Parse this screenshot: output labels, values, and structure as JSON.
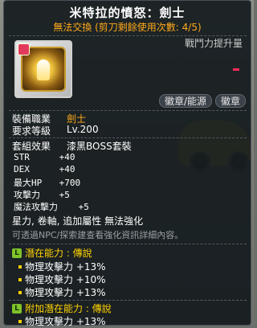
{
  "tooltip": {
    "title": "米特拉的憤怒：劍士",
    "subtitle": "無法交換 (剪刀剩餘使用次數: 4/5)",
    "attack_increase_label": "戰鬥力提升量"
  },
  "emblem_buttons": [
    {
      "label": "徽章/能源"
    },
    {
      "label": "徽章"
    }
  ],
  "requirements": {
    "job_label": "裝備職業",
    "job_value": "劍士",
    "level_label": "要求等級",
    "level_value": "Lv.200"
  },
  "set_effect": {
    "label": "套組效果",
    "value": "漆黑BOSS套裝"
  },
  "stats": [
    {
      "name": "STR",
      "value": "+40"
    },
    {
      "name": "DEX",
      "value": "+40"
    },
    {
      "name": "最大HP",
      "value": "+700"
    },
    {
      "name": "攻擊力",
      "value": "+5"
    },
    {
      "name": "魔法攻擊力",
      "value": "+5"
    }
  ],
  "notes": {
    "upgrade_line": "星力, 卷軸, 追加屬性 無法強化",
    "npc_line": "可透過NPC/探索建查看強化資訊詳細內容。"
  },
  "potential": {
    "icon": "L",
    "header": "潛在能力 : 傳說",
    "lines": [
      {
        "text": "物理攻擊力 +13%"
      },
      {
        "text": "物理攻擊力 +10%"
      },
      {
        "text": "物理攻擊力 +13%"
      }
    ]
  },
  "additional_potential": {
    "icon": "L",
    "header": "附加潛在能力 : 傳說",
    "lines": [
      {
        "text": "物理攻擊力 +13%"
      }
    ]
  },
  "colors": {
    "title": "#ffffff",
    "untradeable": "#ffa91b",
    "potential_header": "#ffd200",
    "legendary_icon": "#7fc32a",
    "panel_bg": "#12181c"
  }
}
